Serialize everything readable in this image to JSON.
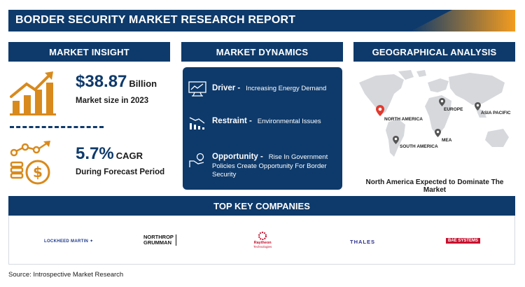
{
  "title": "BORDER SECURITY MARKET RESEARCH REPORT",
  "sections": {
    "insight": "MARKET INSIGHT",
    "dynamics": "MARKET DYNAMICS",
    "geo": "GEOGRAPHICAL ANALYSIS",
    "companies": "TOP KEY COMPANIES"
  },
  "insight": {
    "market_value": "$38.87",
    "market_unit": "Billion",
    "market_sub": "Market size in 2023",
    "cagr_value": "5.7%",
    "cagr_unit": "CAGR",
    "cagr_sub": "During Forecast Period"
  },
  "dynamics": {
    "driver_key": "Driver -",
    "driver_text": "Increasing Energy Demand",
    "restraint_key": "Restraint -",
    "restraint_text": "Environmental Issues",
    "opportunity_key": "Opportunity -",
    "opportunity_text": "Rise In Government Policies Create Opportunity For Border Security"
  },
  "geo": {
    "regions": {
      "north_america": "NORTH AMERICA",
      "europe": "EUROPE",
      "asia_pacific": "ASIA PACIFIC",
      "south_america": "SOUTH AMERICA",
      "mea": "MEA"
    },
    "caption": "North America Expected to Dominate The Market"
  },
  "companies": {
    "lockheed": "LOCKHEED MARTIN",
    "northrop_1": "NORTHROP",
    "northrop_2": "GRUMMAN",
    "raytheon_1": "Raytheon",
    "raytheon_2": "Technologies",
    "thales": "THALES",
    "bae": "BAE SYSTEMS"
  },
  "source": "Source: Introspective Market Research",
  "colors": {
    "navy": "#0e3a6b",
    "orange": "#d88a1d",
    "red_pin": "#e23a2f",
    "map_gray": "#d6d8dc"
  }
}
